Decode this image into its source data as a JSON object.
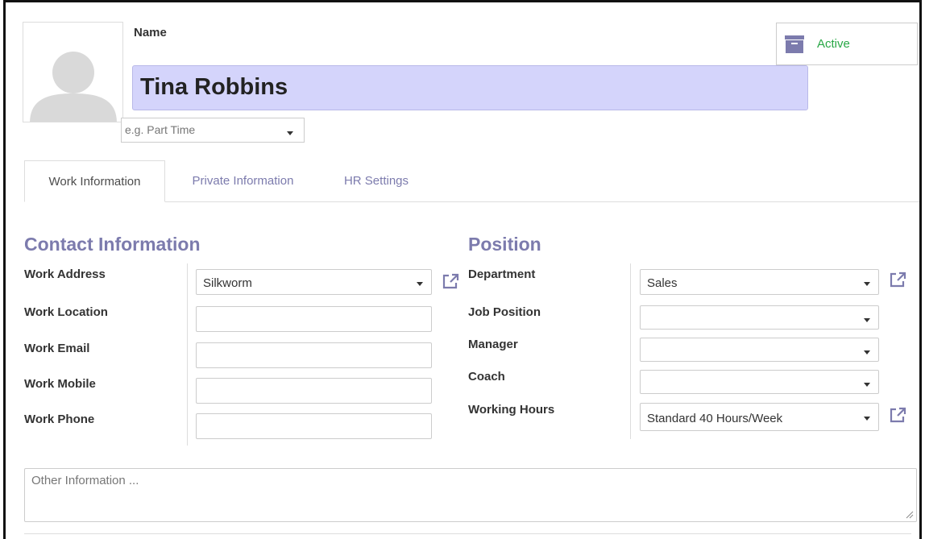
{
  "header": {
    "name_label": "Name",
    "employee_name": "Tina Robbins",
    "tags_placeholder": "e.g. Part Time",
    "status_button": "Active"
  },
  "tabs": [
    {
      "label": "Work Information",
      "active": true
    },
    {
      "label": "Private Information",
      "active": false
    },
    {
      "label": "HR Settings",
      "active": false
    }
  ],
  "contact": {
    "title": "Contact Information",
    "work_address_label": "Work Address",
    "work_address_value": "Silkworm",
    "work_location_label": "Work Location",
    "work_location_value": "",
    "work_email_label": "Work Email",
    "work_email_value": "",
    "work_mobile_label": "Work Mobile",
    "work_mobile_value": "",
    "work_phone_label": "Work Phone",
    "work_phone_value": ""
  },
  "position": {
    "title": "Position",
    "department_label": "Department",
    "department_value": "Sales",
    "job_position_label": "Job Position",
    "job_position_value": "",
    "manager_label": "Manager",
    "manager_value": "",
    "coach_label": "Coach",
    "coach_value": "",
    "working_hours_label": "Working Hours",
    "working_hours_value": "Standard 40 Hours/Week"
  },
  "notes": {
    "placeholder": "Other Information ..."
  },
  "colors": {
    "accent": "#7c7bad",
    "name_bg": "#d4d4fb",
    "active_green": "#28a745"
  }
}
